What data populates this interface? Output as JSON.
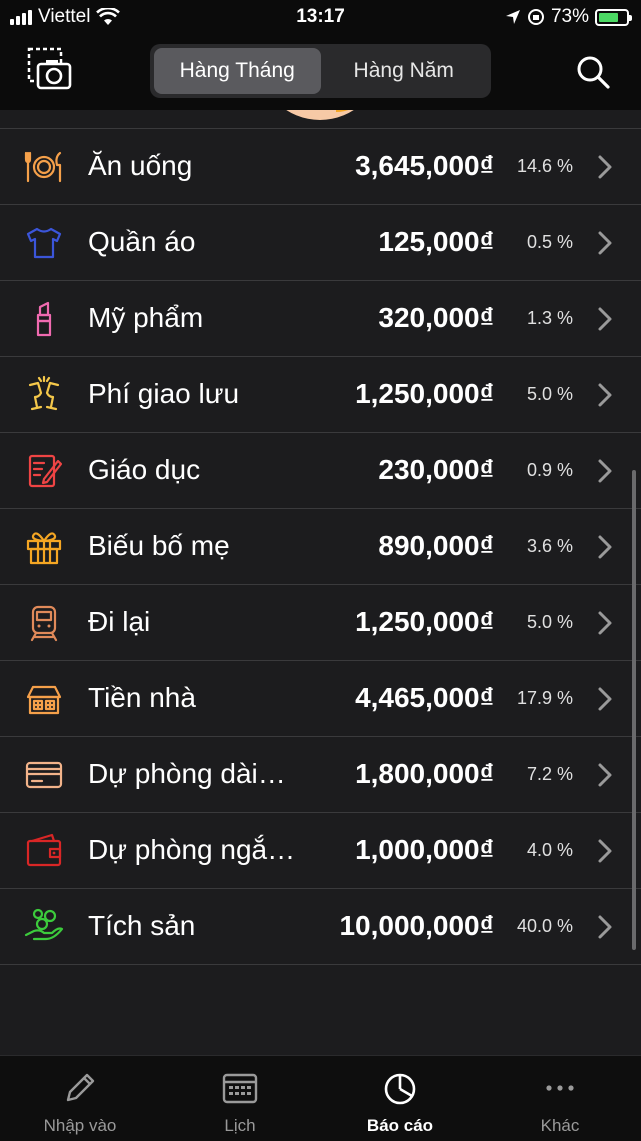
{
  "status_bar": {
    "carrier": "Viettel",
    "time": "13:17",
    "battery": "73%",
    "battery_level": 0.73
  },
  "header": {
    "segments": [
      {
        "label": "Hàng Tháng",
        "active": true
      },
      {
        "label": "Hàng Năm",
        "active": false
      }
    ]
  },
  "categories": [
    {
      "name": "Ăn uống",
      "amount": "3,645,000₫",
      "percent": "14.6 %",
      "icon": "dining-icon",
      "color": "#f5a04a"
    },
    {
      "name": "Quần áo",
      "amount": "125,000₫",
      "percent": "0.5 %",
      "icon": "tshirt-icon",
      "color": "#3b55d9"
    },
    {
      "name": "Mỹ phẩm",
      "amount": "320,000₫",
      "percent": "1.3 %",
      "icon": "lipstick-icon",
      "color": "#f06ab0"
    },
    {
      "name": "Phí giao lưu",
      "amount": "1,250,000₫",
      "percent": "5.0 %",
      "icon": "cheers-icon",
      "color": "#f5c84a"
    },
    {
      "name": "Giáo dục",
      "amount": "230,000₫",
      "percent": "0.9 %",
      "icon": "education-icon",
      "color": "#ef4444"
    },
    {
      "name": "Biếu bố mẹ",
      "amount": "890,000₫",
      "percent": "3.6 %",
      "icon": "gift-icon",
      "color": "#f5a623"
    },
    {
      "name": "Đi lại",
      "amount": "1,250,000₫",
      "percent": "5.0 %",
      "icon": "train-icon",
      "color": "#e08a5a"
    },
    {
      "name": "Tiền nhà",
      "amount": "4,465,000₫",
      "percent": "17.9 %",
      "icon": "house-icon",
      "color": "#f5a04a"
    },
    {
      "name": "Dự phòng dài…",
      "amount": "1,800,000₫",
      "percent": "7.2 %",
      "icon": "card-icon",
      "color": "#f2b38a"
    },
    {
      "name": "Dự phòng ngắ…",
      "amount": "1,000,000₫",
      "percent": "4.0 %",
      "icon": "wallet-icon",
      "color": "#d92626"
    },
    {
      "name": "Tích sản",
      "amount": "10,000,000₫",
      "percent": "40.0 %",
      "icon": "savings-icon",
      "color": "#3ccb3c"
    }
  ],
  "tabbar": [
    {
      "label": "Nhập vào",
      "icon": "pencil-icon",
      "active": false
    },
    {
      "label": "Lịch",
      "icon": "calendar-icon",
      "active": false
    },
    {
      "label": "Báo cáo",
      "icon": "pie-chart-icon",
      "active": true
    },
    {
      "label": "Khác",
      "icon": "more-icon",
      "active": false
    }
  ]
}
